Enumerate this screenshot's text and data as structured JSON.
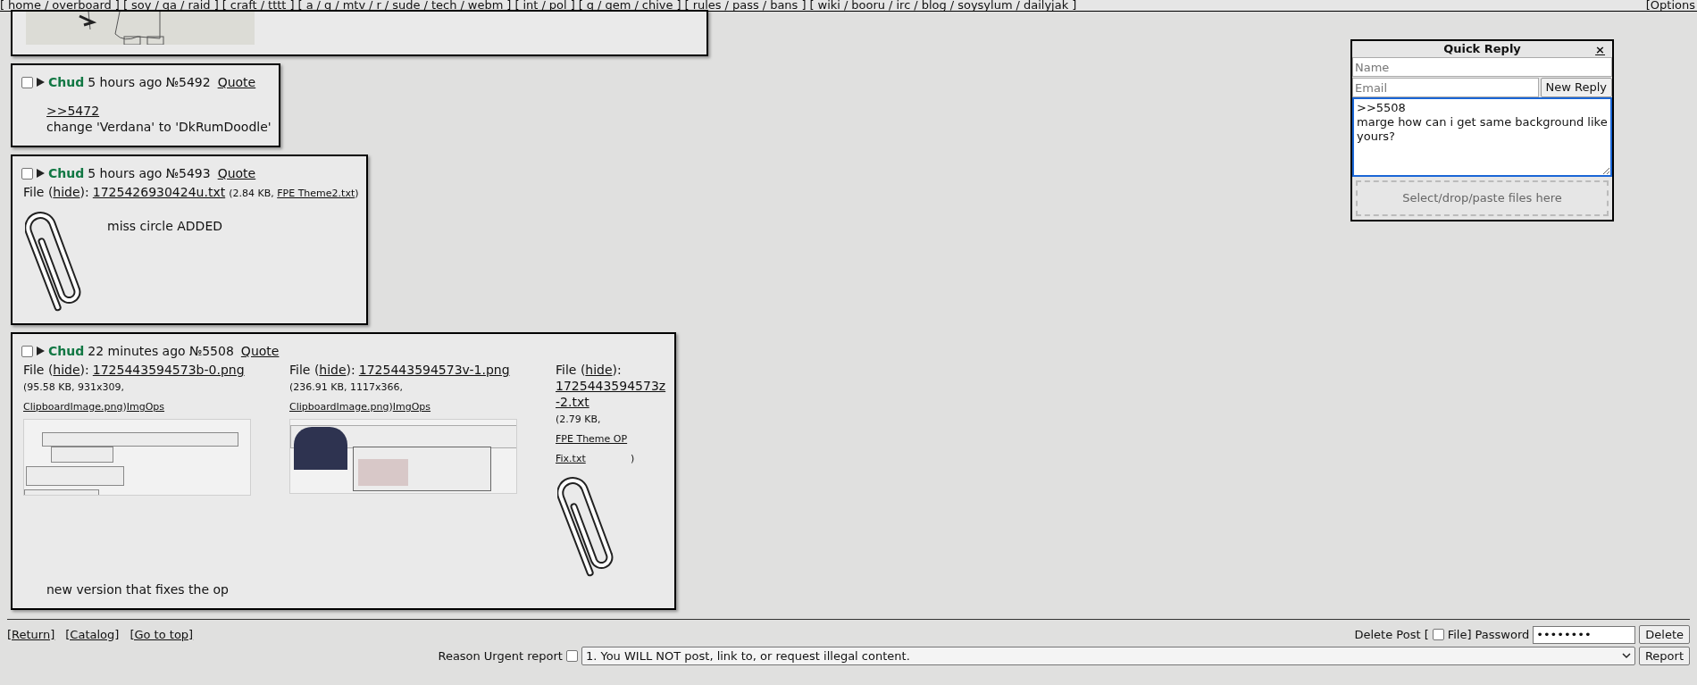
{
  "top_nav": {
    "open": "[",
    "close": "]",
    "separator": "/",
    "groups": [
      [
        "home",
        "overboard"
      ],
      [
        "soy",
        "qa",
        "raid"
      ],
      [
        "craft",
        "tttt"
      ],
      [
        "a",
        "g",
        "mtv",
        "r",
        "sude",
        "tech",
        "webm"
      ],
      [
        "int",
        "pol"
      ],
      [
        "q",
        "gem",
        "chive"
      ],
      [
        "rules",
        "pass",
        "bans"
      ],
      [
        "wiki",
        "booru",
        "irc",
        "blog",
        "soysylum",
        "dailyjak"
      ]
    ],
    "options": "[Options"
  },
  "posts": [
    {
      "kind": "partial",
      "files": [
        {
          "kind": "drawing"
        }
      ]
    },
    {
      "kind": "reply",
      "checked": false,
      "name": "Chud",
      "time": "5 hours ago",
      "number": "№5492",
      "quote": "Quote",
      "body": [
        {
          "kind": "quote_link",
          "text": ">>5472"
        },
        {
          "kind": "text",
          "text": "change 'Verdana' to 'DkRumDoodle'"
        }
      ]
    },
    {
      "kind": "reply",
      "checked": false,
      "name": "Chud",
      "time": "5 hours ago",
      "number": "№5493",
      "quote": "Quote",
      "files": [
        {
          "kind": "text",
          "label_prefix": "File (",
          "hide": "hide",
          "label_suffix": "):",
          "filename": "1725426930424u.txt",
          "meta_prefix": "(2.84 KB,",
          "original": "FPE Theme2.txt",
          "meta_suffix": ")"
        }
      ],
      "body": [
        {
          "kind": "text",
          "text": "miss circle ADDED"
        }
      ]
    },
    {
      "kind": "reply",
      "checked": false,
      "name": "Chud",
      "time": "22 minutes ago",
      "number": "№5508",
      "quote": "Quote",
      "files": [
        {
          "kind": "image",
          "label_prefix": "File (",
          "hide": "hide",
          "label_suffix": "):",
          "filename": "1725443594573b-0.png",
          "meta_prefix": "(95.58 KB, 931x309,",
          "original": "ClipboardImage.png",
          "meta_suffix": ")",
          "imgops": "ImgOps"
        },
        {
          "kind": "image",
          "label_prefix": "File (",
          "hide": "hide",
          "label_suffix": "):",
          "filename": "1725443594573v-1.png",
          "meta_prefix": "(236.91 KB, 1117x366,",
          "original": "ClipboardImage.png",
          "meta_suffix": ")",
          "imgops": "ImgOps"
        },
        {
          "kind": "text",
          "label_prefix": "File (",
          "hide": "hide",
          "label_suffix": "):",
          "filename": "1725443594573z-2.txt",
          "meta_prefix": "(2.79 KB,",
          "original": "FPE Theme OP Fix.txt",
          "meta_suffix": ")"
        }
      ],
      "body": [
        {
          "kind": "text",
          "text": "new version that fixes the op"
        }
      ]
    }
  ],
  "quick_reply": {
    "title": "Quick Reply",
    "close": "×",
    "name": {
      "placeholder": "Name"
    },
    "email": {
      "placeholder": "Email"
    },
    "submit": "New Reply",
    "comment": {
      "value": ">>5508\nmarge how can i get same background like yours?"
    },
    "dropzone": "Select/drop/paste files here"
  },
  "footer": {
    "links": [
      "[Return]",
      "[Catalog]",
      "[Go to top]"
    ],
    "delete": {
      "label": "Delete Post [",
      "file_checked": false,
      "file_label": "File]",
      "password_label": "Password",
      "password": "••••••••",
      "button": "Delete"
    },
    "report": {
      "reason_label": "Reason",
      "urgent_label": "Urgent report",
      "urgent_checked": false,
      "rule": "1. You WILL NOT post, link to, or request illegal content.",
      "button": "Report"
    }
  }
}
